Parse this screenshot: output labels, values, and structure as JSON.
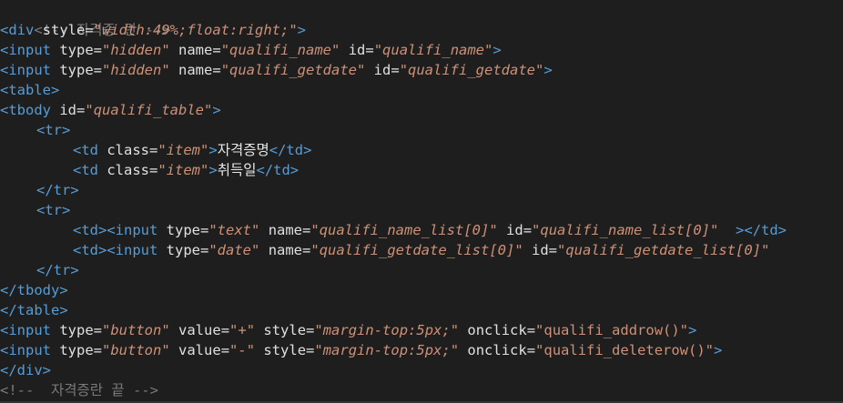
{
  "code": {
    "comment_start": "<!-- 자격증 란 -->",
    "comment_end": "<!--  자격증란 끝 -->",
    "div_open": "<div",
    "style_attr": "style",
    "div_style_value": "\"width:49%;float:right;\"",
    "gt": ">",
    "input_open": "<input",
    "type_attr": "type",
    "name_attr": "name",
    "id_attr": "id",
    "value_attr": "value",
    "onclick_attr": "onclick",
    "class_attr": "class",
    "hidden_value": "\"hidden\"",
    "qualifi_name_value": "\"qualifi_name\"",
    "qualifi_getdate_value": "\"qualifi_getdate\"",
    "table_open": "<table>",
    "tbody_open": "<tbody",
    "tbody_id_value": "\"qualifi_table\"",
    "tr_open": "<tr>",
    "tr_close": "</tr>",
    "td_open": "<td",
    "td_open_full": "<td>",
    "td_close": "</td>",
    "item_value": "\"item\"",
    "cell_1": "자격증명",
    "cell_2": "취득일",
    "text_value": "\"text\"",
    "date_value": "\"date\"",
    "name_list_value": "\"qualifi_name_list[0]\"",
    "getdate_list_value": "\"qualifi_getdate_list[0]\"",
    "tbody_close": "</tbody>",
    "table_close": "</table>",
    "button_value": "\"button\"",
    "plus_value": "\"+\"",
    "minus_value": "\"-\"",
    "margin_value": "\"margin-top:5px;\"",
    "addrow_value": "\"qualifi_addrow()\"",
    "deleterow_value": "\"qualifi_deleterow()\"",
    "div_close": "</div>",
    "trailing_space": "  "
  }
}
